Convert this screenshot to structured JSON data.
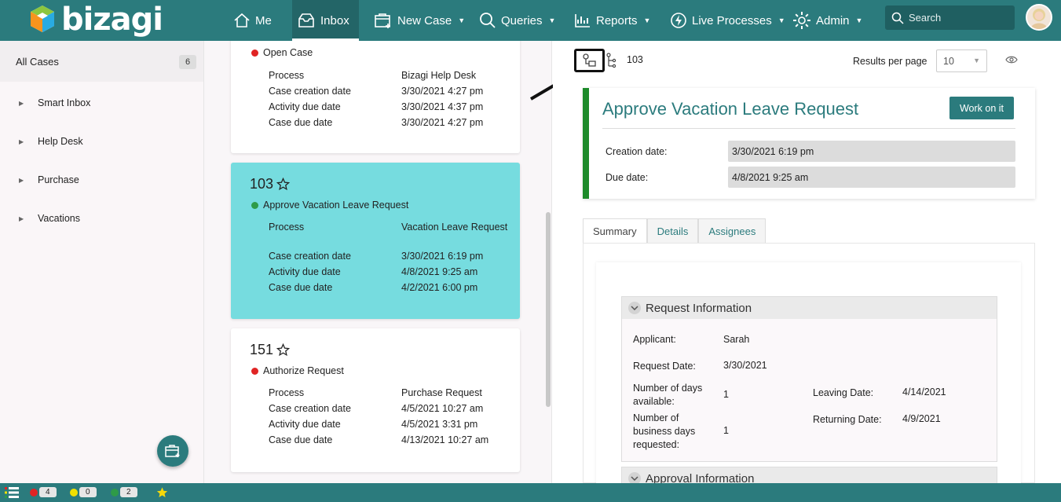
{
  "app": {
    "brand": "bizagi"
  },
  "nav": {
    "me": "Me",
    "inbox": "Inbox",
    "new_case": "New Case",
    "queries": "Queries",
    "reports": "Reports",
    "live_processes": "Live Processes",
    "admin": "Admin",
    "search_placeholder": "Search"
  },
  "sidebar": {
    "all_cases_label": "All Cases",
    "all_cases_count": "6",
    "items": [
      {
        "label": "Smart Inbox"
      },
      {
        "label": "Help Desk"
      },
      {
        "label": "Purchase"
      },
      {
        "label": "Vacations"
      }
    ]
  },
  "cases": [
    {
      "number": "",
      "activity": "Open Case",
      "status_color": "#e02424",
      "fields": [
        {
          "label": "Process",
          "value": "Bizagi Help Desk"
        },
        {
          "label": "Case creation date",
          "value": "3/30/2021 4:27 pm"
        },
        {
          "label": "Activity due date",
          "value": "3/30/2021 4:37 pm"
        },
        {
          "label": "Case due date",
          "value": "3/30/2021 4:27 pm"
        }
      ]
    },
    {
      "number": "103",
      "activity": "Approve Vacation Leave Request",
      "status_color": "#2e9b48",
      "selected": true,
      "fields": [
        {
          "label": "Process",
          "value": "Vacation Leave Request"
        },
        {
          "label": "Case creation date",
          "value": "3/30/2021 6:19 pm"
        },
        {
          "label": "Activity due date",
          "value": "4/8/2021 9:25 am"
        },
        {
          "label": "Case due date",
          "value": "4/2/2021 6:00 pm"
        }
      ]
    },
    {
      "number": "151",
      "activity": "Authorize Request",
      "status_color": "#e02424",
      "fields": [
        {
          "label": "Process",
          "value": "Purchase Request"
        },
        {
          "label": "Case creation date",
          "value": "4/5/2021 10:27 am"
        },
        {
          "label": "Activity due date",
          "value": "4/5/2021 3:31 pm"
        },
        {
          "label": "Case due date",
          "value": "4/13/2021 10:27 am"
        }
      ]
    }
  ],
  "detail": {
    "case_number": "103",
    "results_per_page_label": "Results per page",
    "results_per_page_value": "10",
    "title": "Approve Vacation Leave Request",
    "work_button": "Work on it",
    "creation_label": "Creation date:",
    "creation_value": "3/30/2021 6:19 pm",
    "due_label": "Due date:",
    "due_value": "4/8/2021 9:25 am",
    "tabs": [
      "Summary",
      "Details",
      "Assignees"
    ],
    "request_section": "Request Information",
    "approval_section": "Approval Information",
    "applicant_label": "Applicant:",
    "applicant_value": "Sarah",
    "request_date_label": "Request Date:",
    "request_date_value": "3/30/2021",
    "days_available_label": "Number of days available:",
    "days_available_value": "1",
    "business_days_label": "Number of business days requested:",
    "business_days_value": "1",
    "leaving_label": "Leaving Date:",
    "leaving_value": "4/14/2021",
    "returning_label": "Returning Date:",
    "returning_value": "4/9/2021"
  },
  "footer": {
    "red_count": "4",
    "yellow_count": "0",
    "green_count": "2"
  },
  "colors": {
    "brand": "#2b7b7d",
    "selected_card": "#76dcdf",
    "accent_bar": "#1d8a2a"
  }
}
